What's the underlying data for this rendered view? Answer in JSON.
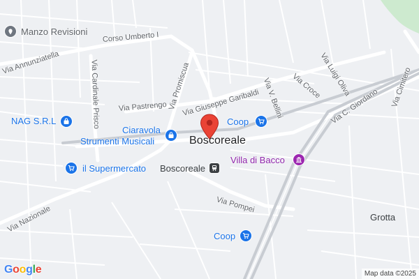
{
  "map": {
    "center_label": "Boscoreale",
    "area_label": "Grotta",
    "station_label": "Boscoreale",
    "attribution": "Map data ©2025",
    "logo_text": [
      "G",
      "o",
      "o",
      "g",
      "l",
      "e"
    ],
    "logo_colors": [
      "#4285F4",
      "#EA4335",
      "#FBBC05",
      "#4285F4",
      "#34A853",
      "#EA4335"
    ],
    "marker_color": "#EA4335",
    "shop_color": "#1a73e8",
    "attraction_color": "#8e24aa"
  },
  "streets": [
    "Corso Umberto I",
    "Via Annunziatella",
    "Via Promiscua",
    "Via Cardinale Prisco",
    "Via Pastrengo",
    "Via Giuseppe Garibaldi",
    "Via V. Bellini",
    "Via Croce",
    "Via Luigi Oliva",
    "Via C. Giordano",
    "Via Cimitero",
    "Via Nazionale",
    "Via Pompei"
  ],
  "pois": [
    {
      "name": "Manzo Revisioni",
      "category": "place",
      "icon": "place-pin-icon"
    },
    {
      "name": "NAG S.R.L",
      "category": "shop",
      "icon": "shopping-bag-icon"
    },
    {
      "name": "Ciaravola Strumenti Musicali",
      "line1": "Ciaravola",
      "line2": "Strumenti Musicali",
      "category": "shop",
      "icon": "shopping-bag-icon"
    },
    {
      "name": "Coop",
      "category": "shop",
      "icon": "shopping-cart-icon"
    },
    {
      "name": "il Supermercato",
      "category": "shop",
      "icon": "shopping-cart-icon"
    },
    {
      "name": "Villa di Bacco",
      "category": "attraction",
      "icon": "museum-icon"
    },
    {
      "name": "Coop",
      "category": "shop",
      "icon": "shopping-cart-icon"
    }
  ]
}
